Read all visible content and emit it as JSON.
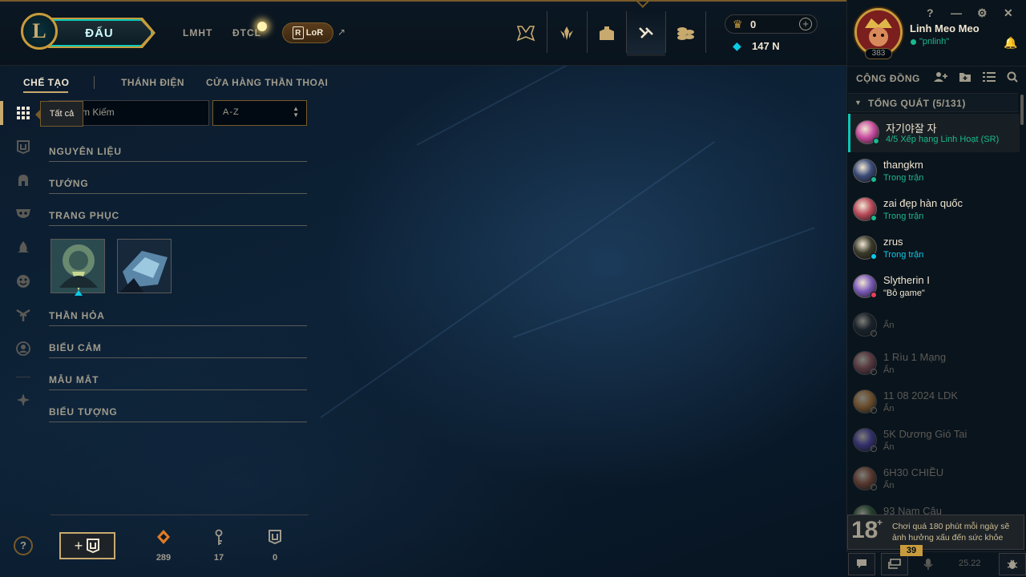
{
  "topbar": {
    "play_button": "ĐẤU",
    "nav": [
      "LMHT",
      "ĐTCL"
    ],
    "lor_label": "LoR",
    "lor_k": "R",
    "ext_arrow": "↗",
    "rp": "0",
    "be": "147 N",
    "plus": "+"
  },
  "subnav": {
    "crafting": "CHẾ TẠO",
    "sanctum": "THÁNH ĐIỆN",
    "mythic_shop": "CỬA HÀNG THẦN THOẠI"
  },
  "rail": {
    "tooltip": "Tất cả"
  },
  "search": {
    "placeholder": "Tìm Kiếm",
    "visible_text": "m Kiếm"
  },
  "sort": {
    "value": "A-Z"
  },
  "categories": {
    "materials": "NGUYÊN LIỆU",
    "champions": "TƯỚNG",
    "skins": "TRANG PHỤC",
    "wards": "THẦN HỎA",
    "emotes": "BIỂU CẢM",
    "eternals": "MẪU MẮT",
    "icons": "BIỂU TƯỢNG"
  },
  "resources": {
    "orange_essence": "289",
    "keys": "17",
    "chests": "0"
  },
  "help": "?",
  "profile": {
    "name": "Linh Meo Meo",
    "status": "\"pnlinh\"",
    "level": "383"
  },
  "window_controls": [
    "?",
    "—",
    "⚙",
    "✕"
  ],
  "social": {
    "community": "CỘNG ĐỒNG",
    "group": "TỔNG QUÁT (5/131)",
    "friends": [
      {
        "name": "자기야잘 자",
        "status": "4/5 Xếp hạng Linh Hoạt (SR)",
        "status_color": "#1ab98c"
      },
      {
        "name": "thangkm",
        "status": "Trong trận",
        "status_color": "#1ab98c"
      },
      {
        "name": "zai đẹp hàn quốc",
        "status": "Trong trận",
        "status_color": "#1ab98c"
      },
      {
        "name": "zrus",
        "status": "Trong trận",
        "status_color": "#0acbe6"
      },
      {
        "name": "Slytherin I",
        "status": "\"Bỏ game\"",
        "status_color": "#f0e6d2"
      },
      {
        "name": "",
        "status": "Ẩn",
        "status_color": "#5b5a56"
      },
      {
        "name": "1 Rìu 1 Mạng",
        "status": "Ẩn",
        "status_color": "#5b5a56"
      },
      {
        "name": "11 08 2024 LDK",
        "status": "Ẩn",
        "status_color": "#5b5a56"
      },
      {
        "name": "5K Dương Gió Tai",
        "status": "Ẩn",
        "status_color": "#5b5a56"
      },
      {
        "name": "6H30 CHIỀU",
        "status": "Ẩn",
        "status_color": "#5b5a56"
      },
      {
        "name": "93 Nam Câu",
        "status": "",
        "status_color": "#5b5a56"
      }
    ],
    "warning_age": "18",
    "warning_plus": "+",
    "warning": "Chơi quá 180 phút mỗi ngày sẽ ảnh hưởng xấu đến sức khỏe",
    "chat_count": "39",
    "version": "25.22"
  },
  "colors": {
    "gold": "#c8aa6e",
    "teal": "#0ac8b9",
    "online": "#1ab98c",
    "blue": "#0acbe6"
  }
}
